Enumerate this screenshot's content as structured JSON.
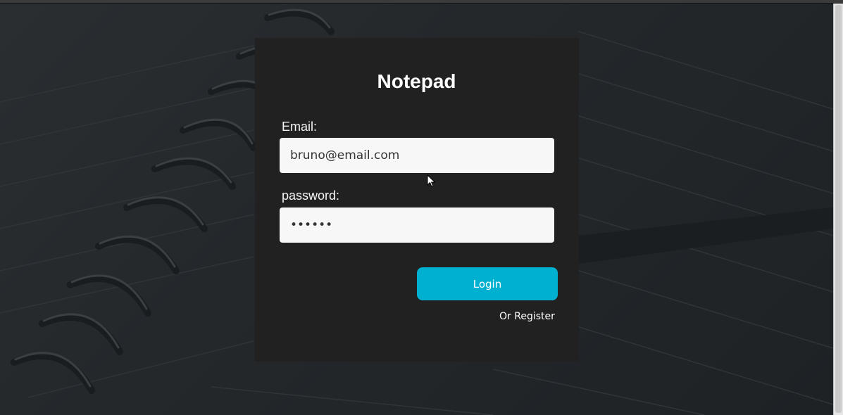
{
  "app": {
    "title": "Notepad"
  },
  "form": {
    "email_label": "Email:",
    "email_value": "bruno@email.com",
    "password_label": "password:",
    "password_value": "abcdef",
    "login_label": "Login",
    "register_label": "Or Register"
  },
  "icons": {
    "cursor": "mouse-pointer-icon"
  },
  "colors": {
    "page_background": "#1f2326",
    "card_background": "#212121",
    "accent": "#00b0d0",
    "input_background": "#f7f7f7",
    "text": "#ffffff"
  }
}
